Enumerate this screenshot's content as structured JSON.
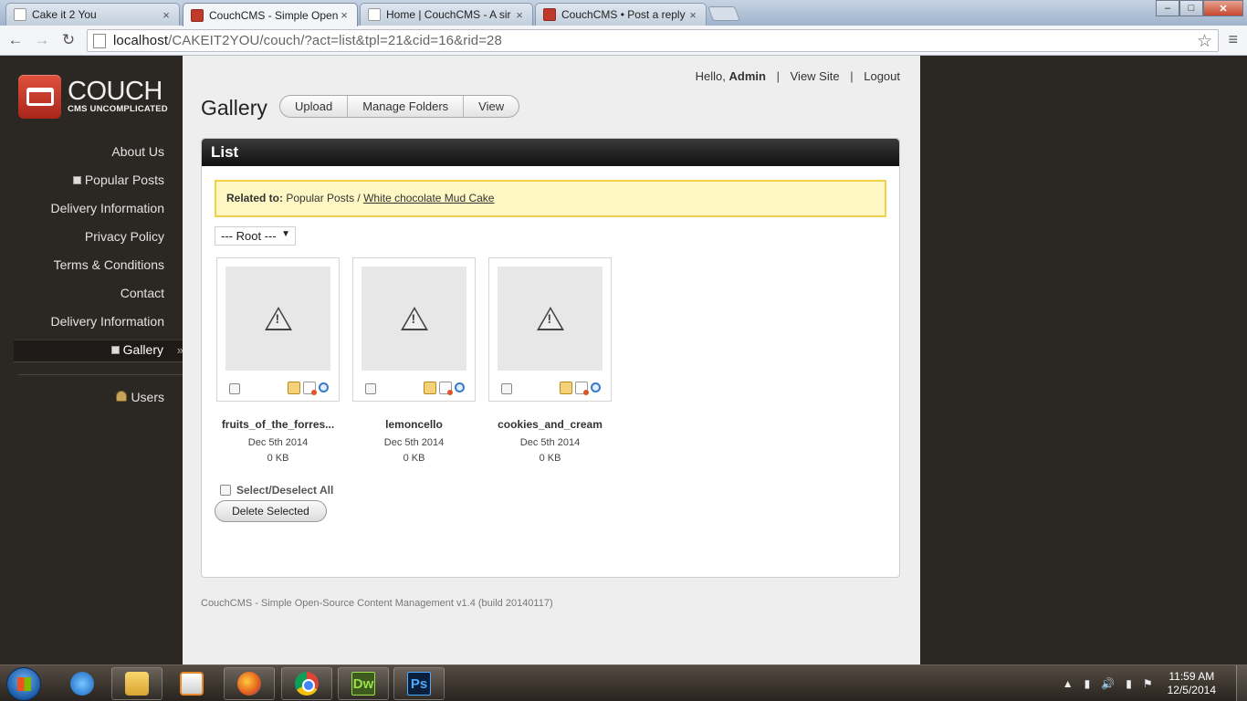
{
  "browser": {
    "tabs": [
      {
        "title": "Cake it 2 You",
        "active": false
      },
      {
        "title": "CouchCMS - Simple Open",
        "active": true
      },
      {
        "title": "Home | CouchCMS - A sir",
        "active": false
      },
      {
        "title": "CouchCMS • Post a reply",
        "active": false
      }
    ],
    "tab_close": "×",
    "url_host": "localhost",
    "url_path": "/CAKEIT2YOU/couch/?act=list&tpl=21&cid=16&rid=28",
    "win_min": "–",
    "win_max": "□",
    "win_close": "✕",
    "back": "←",
    "forward": "→",
    "reload": "↻",
    "star": "☆",
    "menu": "≡"
  },
  "logo": {
    "name": "COUCH",
    "tagline": "CMS UNCOMPLICATED"
  },
  "sidebar": {
    "items": [
      {
        "label": "About Us",
        "icon": "none"
      },
      {
        "label": "Popular Posts",
        "icon": "folder-icon"
      },
      {
        "label": "Delivery Information",
        "icon": "none"
      },
      {
        "label": "Privacy Policy",
        "icon": "none"
      },
      {
        "label": "Terms & Conditions",
        "icon": "none"
      },
      {
        "label": "Contact",
        "icon": "none"
      },
      {
        "label": "Delivery Information",
        "icon": "none"
      },
      {
        "label": "Gallery",
        "icon": "folder-icon",
        "active": true
      },
      {
        "label": "Users",
        "icon": "user-icon"
      }
    ],
    "active_chevron": "»"
  },
  "userbar": {
    "hello": "Hello,",
    "user": "Admin",
    "sep": "|",
    "view_site": "View Site",
    "logout": "Logout"
  },
  "page": {
    "title": "Gallery",
    "actions": [
      "Upload",
      "Manage Folders",
      "View"
    ]
  },
  "panel": {
    "title": "List",
    "related_label": "Related to:",
    "related_parent": "Popular Posts /",
    "related_link": "White chocolate Mud Cake",
    "folder_select": "--- Root ---",
    "folder_arrow": "▼",
    "items": [
      {
        "name": "fruits_of_the_forres...",
        "date": "Dec 5th 2014",
        "size": "0 KB"
      },
      {
        "name": "lemoncello",
        "date": "Dec 5th 2014",
        "size": "0 KB"
      },
      {
        "name": "cookies_and_cream",
        "date": "Dec 5th 2014",
        "size": "0 KB"
      }
    ],
    "select_all": "Select/Deselect All",
    "delete_button": "Delete Selected"
  },
  "footer": "CouchCMS - Simple Open-Source Content Management v1.4 (build 20140117)",
  "taskbar": {
    "apps": [
      "ie-icon",
      "folder-icon",
      "media-player-icon",
      "firefox-icon",
      "chrome-icon",
      "dreamweaver-icon",
      "photoshop-icon"
    ],
    "dw_label": "Dw",
    "ps_label": "Ps",
    "tray_up": "▲",
    "time": "11:59 AM",
    "date": "12/5/2014"
  }
}
